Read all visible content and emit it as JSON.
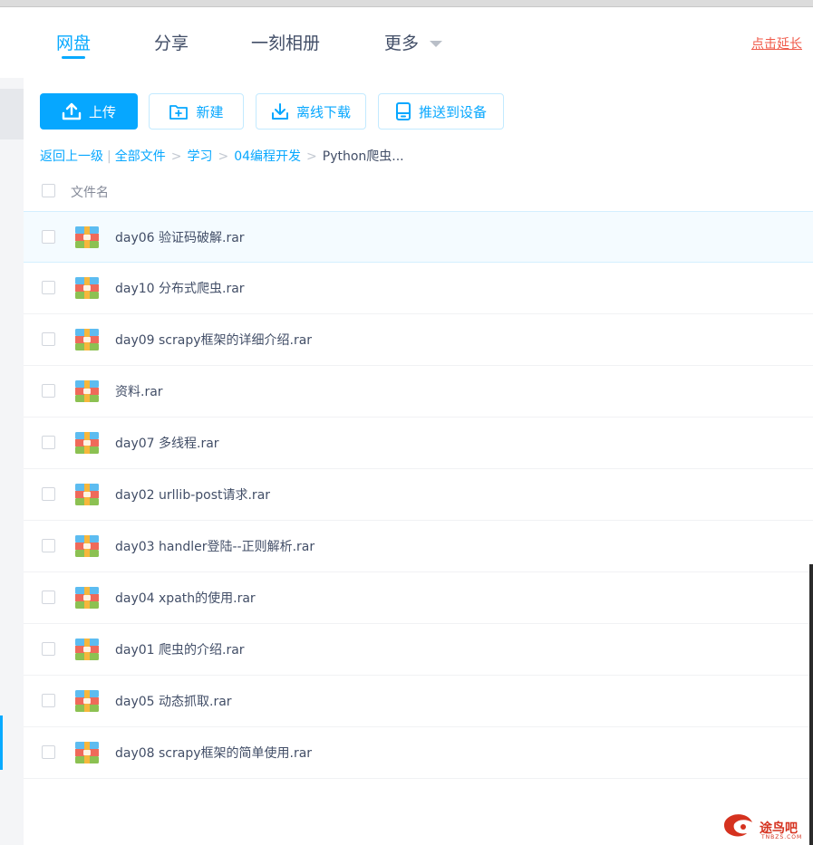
{
  "nav": {
    "tabs": [
      {
        "label": "网盘",
        "active": true
      },
      {
        "label": "分享"
      },
      {
        "label": "一刻相册"
      },
      {
        "label": "更多"
      }
    ],
    "promo": "点击延长",
    "accent": "#09aaff"
  },
  "toolbar": {
    "upload_label": "上传",
    "new_label": "新建",
    "offline_label": "离线下载",
    "push_label": "推送到设备"
  },
  "breadcrumb": {
    "back": "返回上一级",
    "items": [
      "全部文件",
      "学习",
      "04编程开发"
    ],
    "current": "Python爬虫..."
  },
  "table": {
    "header": "文件名",
    "files": [
      "day06 验证码破解.rar",
      "day10 分布式爬虫.rar",
      "day09 scrapy框架的详细介绍.rar",
      "资料.rar",
      "day07 多线程.rar",
      "day02 urllib-post请求.rar",
      "day03 handler登陆--正则解析.rar",
      "day04 xpath的使用.rar",
      "day01 爬虫的介绍.rar",
      "day05 动态抓取.rar",
      "day08 scrapy框架的简单使用.rar"
    ]
  },
  "watermark": {
    "name": "途鸟吧",
    "site": "TNBZS.COM"
  }
}
